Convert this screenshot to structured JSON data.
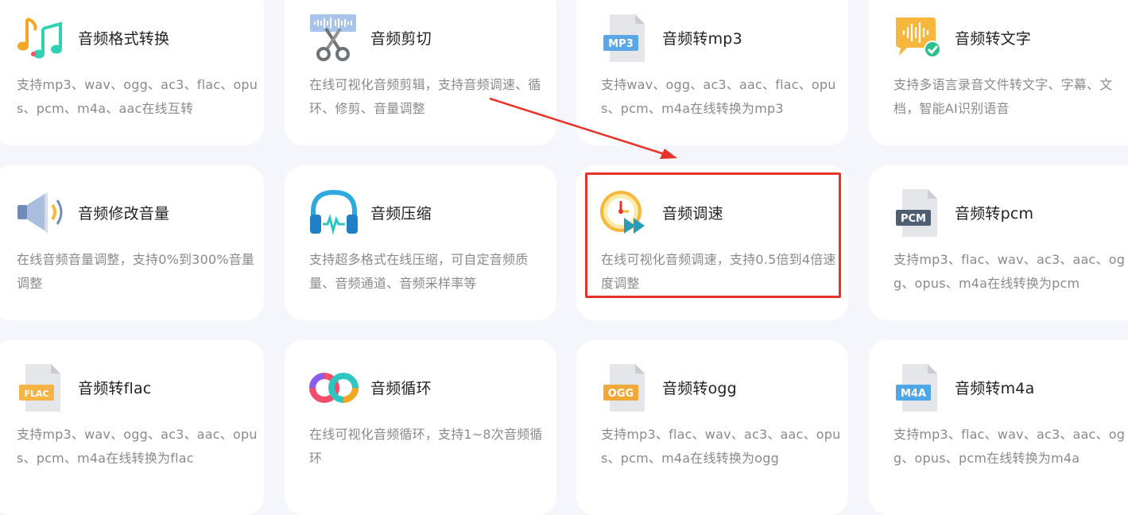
{
  "tools": [
    {
      "title": "音频格式转换",
      "desc": "支持mp3、wav、ogg、ac3、flac、opus、pcm、m4a、aac在线互转",
      "icon": "music-notes-icon"
    },
    {
      "title": "音频剪切",
      "desc": "在线可视化音频剪辑，支持音频调速、循环、修剪、音量调整",
      "icon": "scissors-waveform-icon"
    },
    {
      "title": "音频转mp3",
      "desc": "支持wav、ogg、ac3、aac、flac、opus、pcm、m4a在线转换为mp3",
      "icon": "mp3-file-icon",
      "badge": "MP3"
    },
    {
      "title": "音频转文字",
      "desc": "支持多语言录音文件转文字、字幕、文档，智能AI识别语音",
      "icon": "speech-bubble-check-icon"
    },
    {
      "title": "音频修改音量",
      "desc": "在线音频音量调整，支持0%到300%音量调整",
      "icon": "speaker-volume-icon"
    },
    {
      "title": "音频压缩",
      "desc": "支持超多格式在线压缩，可自定音频质量、音频通道、音频采样率等",
      "icon": "headphones-icon"
    },
    {
      "title": "音频调速",
      "desc": "在线可视化音频调速，支持0.5倍到4倍速度调整",
      "icon": "clock-fast-forward-icon"
    },
    {
      "title": "音频转pcm",
      "desc": "支持mp3、flac、wav、ac3、aac、ogg、opus、m4a在线转换为pcm",
      "icon": "pcm-file-icon",
      "badge": "PCM"
    },
    {
      "title": "音频转flac",
      "desc": "支持mp3、wav、ogg、ac3、aac、opus、pcm、m4a在线转换为flac",
      "icon": "flac-file-icon",
      "badge": "FLAC"
    },
    {
      "title": "音频循环",
      "desc": "在线可视化音频循环，支持1~8次音频循环",
      "icon": "loop-infinity-icon"
    },
    {
      "title": "音频转ogg",
      "desc": "支持mp3、flac、wav、ac3、aac、opus、pcm、m4a在线转换为ogg",
      "icon": "ogg-file-icon",
      "badge": "OGG"
    },
    {
      "title": "音频转m4a",
      "desc": "支持mp3、flac、wav、ac3、aac、ogg、opus、pcm在线转换为m4a",
      "icon": "m4a-file-icon",
      "badge": "M4A"
    }
  ],
  "colors": {
    "page_background": "#f5f6fb",
    "card_background": "#ffffff",
    "title_text": "#222222",
    "description_text": "#8a8a8a",
    "highlight": "#e8332a",
    "mp3_badge": "#5aa7e8",
    "pcm_badge": "#4f5f73",
    "flac_badge": "#f5b443",
    "ogg_badge": "#f0a838",
    "m4a_badge": "#4fa6e6"
  }
}
